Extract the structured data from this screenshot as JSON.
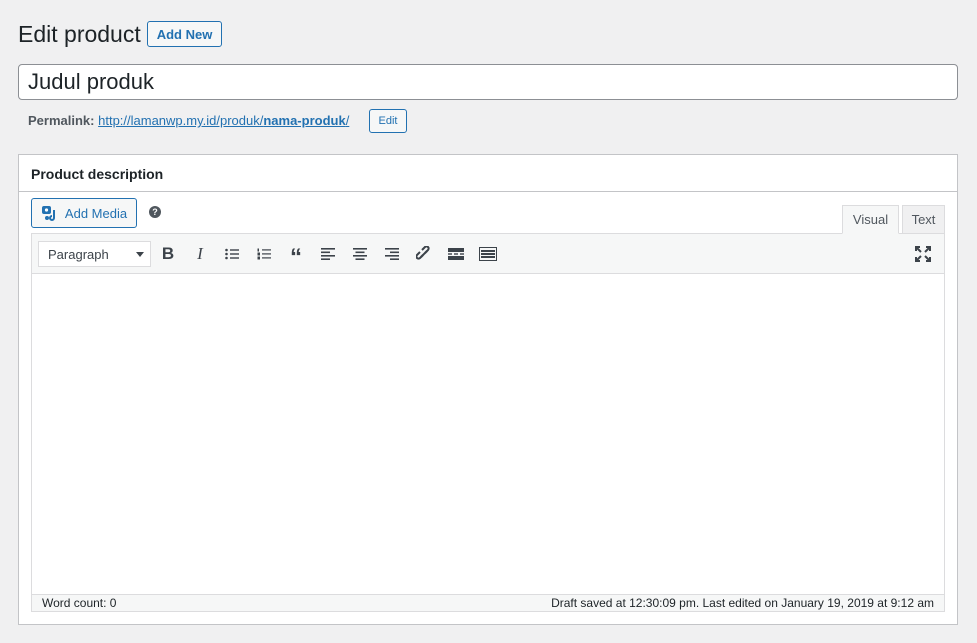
{
  "page": {
    "title": "Edit product",
    "add_new": "Add New"
  },
  "title_input": {
    "value": "Judul produk"
  },
  "permalink": {
    "label": "Permalink:",
    "url_base": "http://lamanwp.my.id/produk/",
    "slug": "nama-produk",
    "trailing": "/",
    "edit": "Edit"
  },
  "postbox": {
    "title": "Product description"
  },
  "editor": {
    "add_media": "Add Media",
    "tabs": [
      "Visual",
      "Text"
    ],
    "active_tab": "Visual",
    "format": "Paragraph",
    "toolbar": [
      "bold",
      "italic",
      "bulleted-list",
      "numbered-list",
      "blockquote",
      "align-left",
      "align-center",
      "align-right",
      "link",
      "read-more",
      "toolbar-toggle"
    ],
    "word_count": "Word count: 0",
    "draft_status": "Draft saved at 12:30:09 pm. Last edited on January 19, 2019 at 9:12 am"
  },
  "colors": {
    "accent": "#2271b1"
  }
}
